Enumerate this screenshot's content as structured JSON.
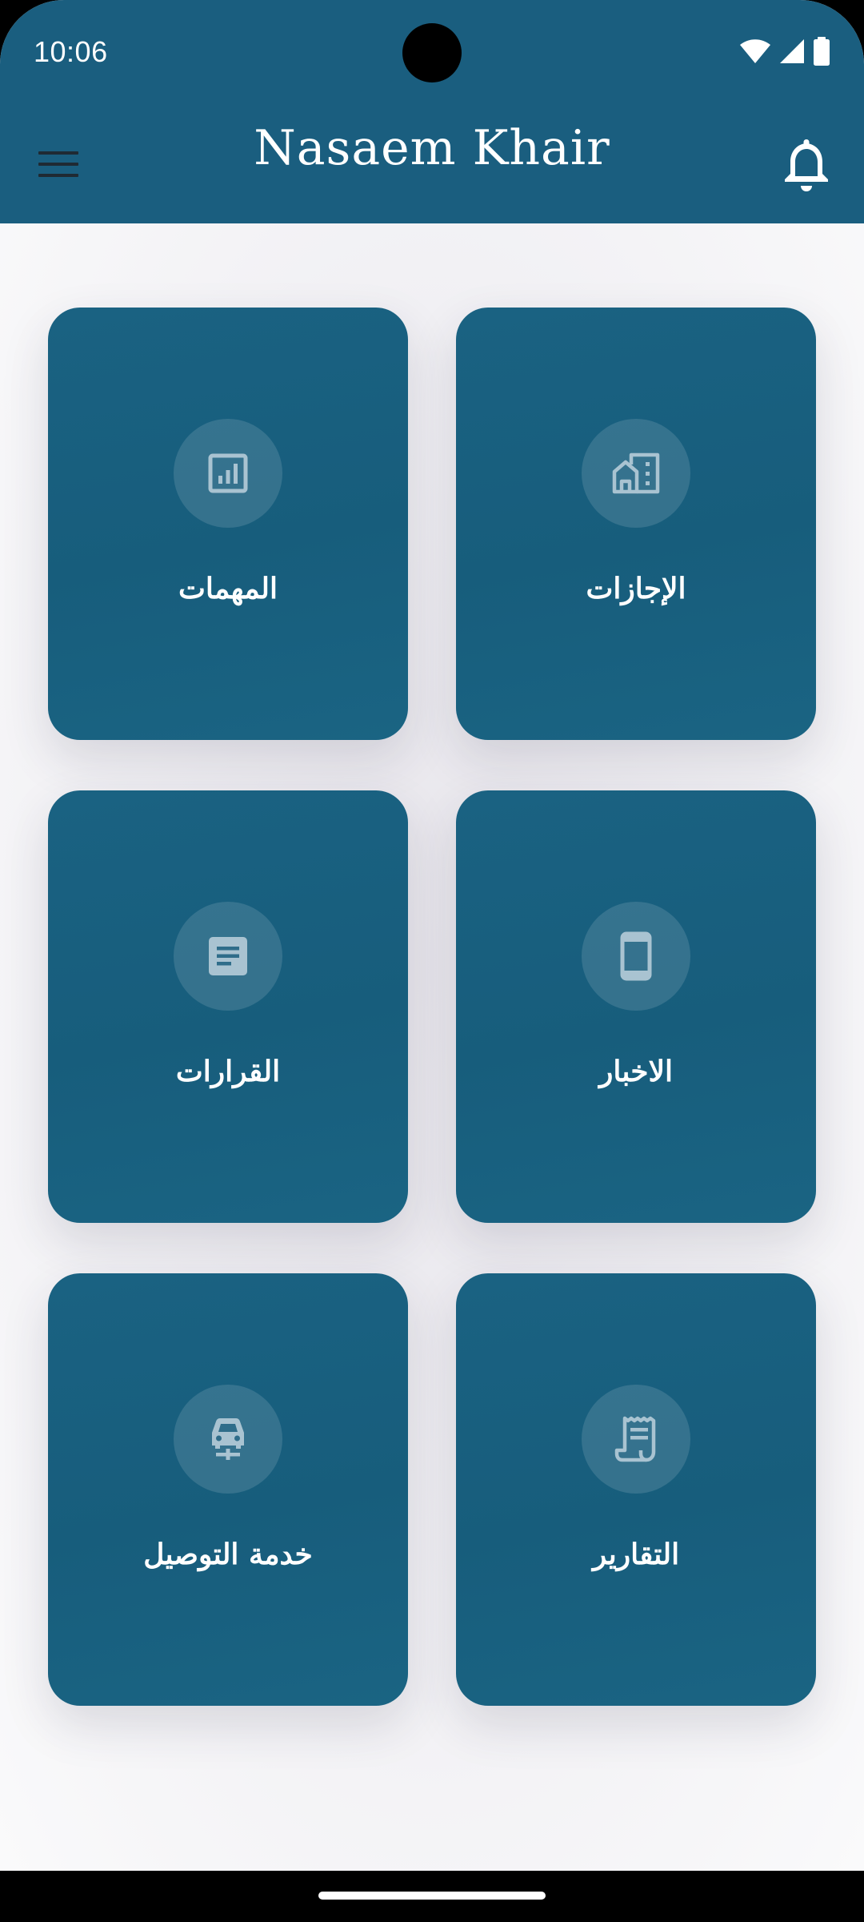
{
  "status_bar": {
    "time": "10:06",
    "icons": [
      "wifi-icon",
      "cellular-signal-icon",
      "battery-icon"
    ]
  },
  "app_bar": {
    "title": "Nasaem Khair",
    "menu_icon": "hamburger-menu-icon",
    "notification_icon": "bell-icon",
    "background_color": "#1a5e7f"
  },
  "tiles": [
    {
      "label": "الإجازات",
      "icon": "home-building-icon"
    },
    {
      "label": "المهمات",
      "icon": "analytics-chart-icon"
    },
    {
      "label": "الاخبار",
      "icon": "phone-news-icon"
    },
    {
      "label": "القرارات",
      "icon": "article-document-icon"
    },
    {
      "label": "التقارير",
      "icon": "receipt-report-icon"
    },
    {
      "label": "خدمة التوصيل",
      "icon": "car-delivery-icon"
    }
  ],
  "colors": {
    "tile_background": "#1a6080",
    "page_background": "#f4f3f6",
    "icon_tint": "#a9c3d1"
  }
}
